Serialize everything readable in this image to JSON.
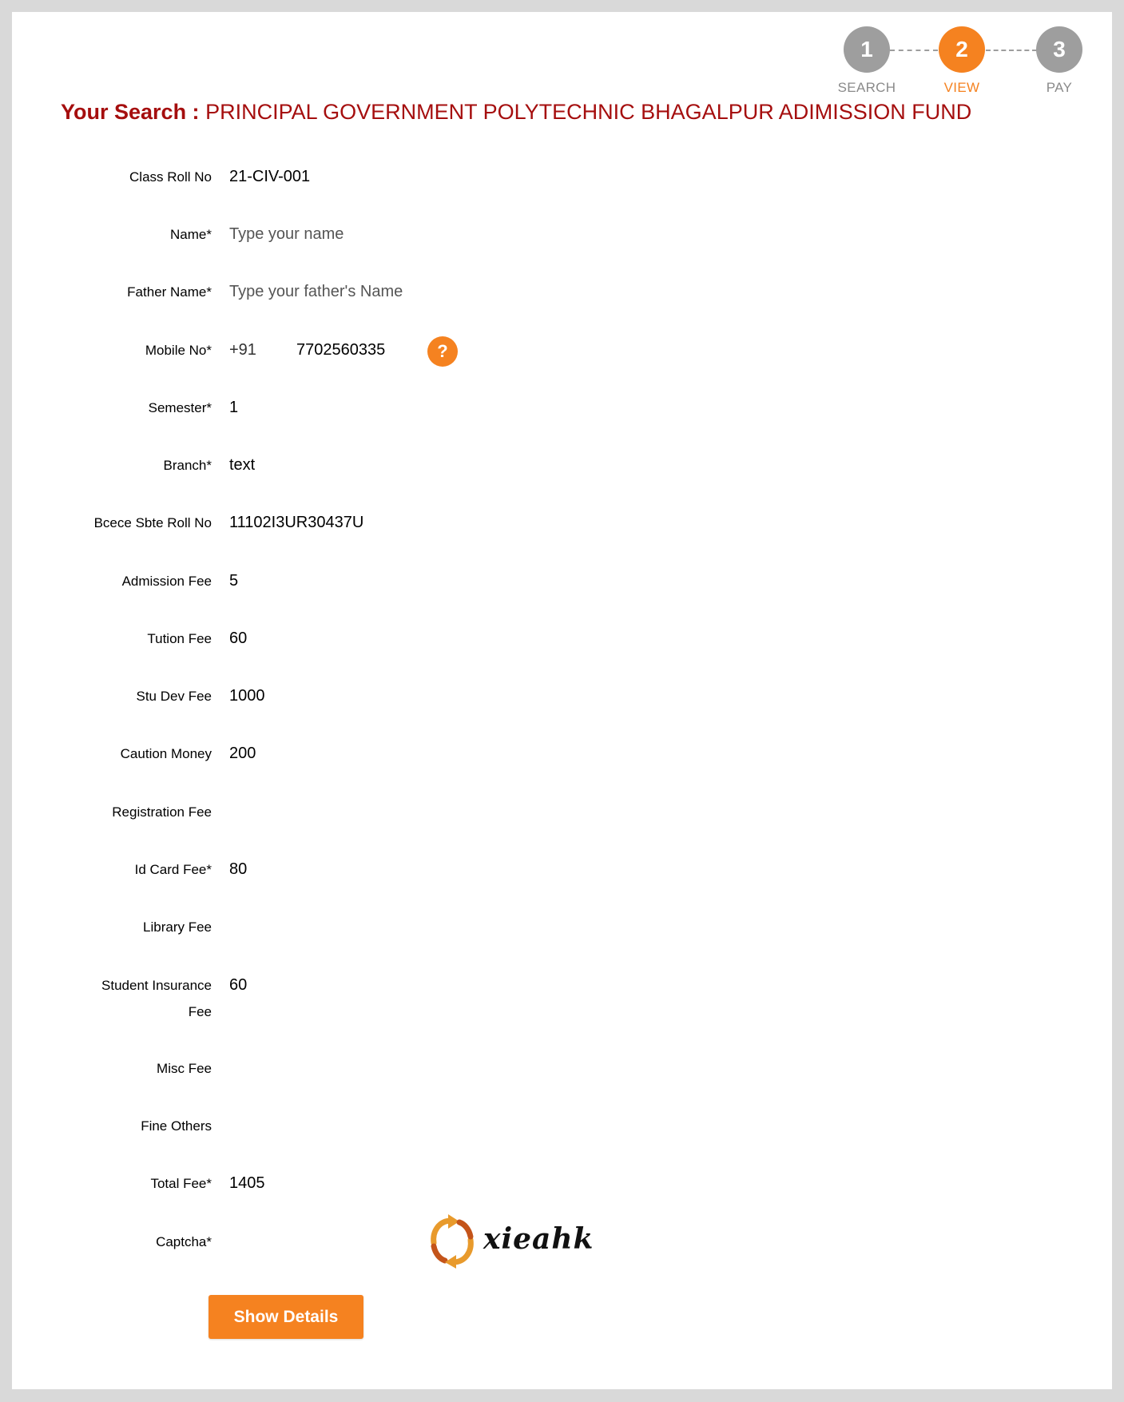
{
  "steps": [
    {
      "number": "1",
      "label": "SEARCH"
    },
    {
      "number": "2",
      "label": "VIEW"
    },
    {
      "number": "3",
      "label": "PAY"
    }
  ],
  "search": {
    "label": "Your Search :",
    "value": "PRINCIPAL GOVERNMENT POLYTECHNIC BHAGALPUR ADIMISSION FUND"
  },
  "form": {
    "class_roll_no": {
      "label": "Class Roll No",
      "value": "21-CIV-001"
    },
    "name": {
      "label": "Name*",
      "placeholder": "Type your name"
    },
    "father_name": {
      "label": "Father Name*",
      "placeholder": "Type your father's Name"
    },
    "mobile": {
      "label": "Mobile No*",
      "prefix": "+91",
      "value": "7702560335",
      "help_icon": "?"
    },
    "semester": {
      "label": "Semester*",
      "value": "1"
    },
    "branch": {
      "label": "Branch*",
      "value": "text"
    },
    "bcece_roll": {
      "label": "Bcece Sbte Roll No",
      "value": "11102I3UR30437U"
    },
    "admission_fee": {
      "label": "Admission Fee",
      "value": "5"
    },
    "tution_fee": {
      "label": "Tution Fee",
      "value": "60"
    },
    "stu_dev_fee": {
      "label": "Stu Dev Fee",
      "value": "1000"
    },
    "caution_money": {
      "label": "Caution Money",
      "value": "200"
    },
    "registration_fee": {
      "label": "Registration Fee",
      "value": ""
    },
    "id_card_fee": {
      "label": "Id Card Fee*",
      "value": "80"
    },
    "library_fee": {
      "label": "Library Fee",
      "value": ""
    },
    "student_insurance_fee": {
      "label_line1": "Student Insurance",
      "label_line2": "Fee",
      "value": "60"
    },
    "misc_fee": {
      "label": "Misc Fee",
      "value": ""
    },
    "fine_others": {
      "label": "Fine Others",
      "value": ""
    },
    "total_fee": {
      "label": "Total Fee*",
      "value": "1405"
    },
    "captcha": {
      "label": "Captcha*",
      "text": "xieahk",
      "refresh_icon": "refresh-icon"
    }
  },
  "buttons": {
    "show_details": "Show Details"
  },
  "colors": {
    "accent": "#f58220",
    "heading": "#a50e0e",
    "inactive": "#9e9e9e"
  }
}
